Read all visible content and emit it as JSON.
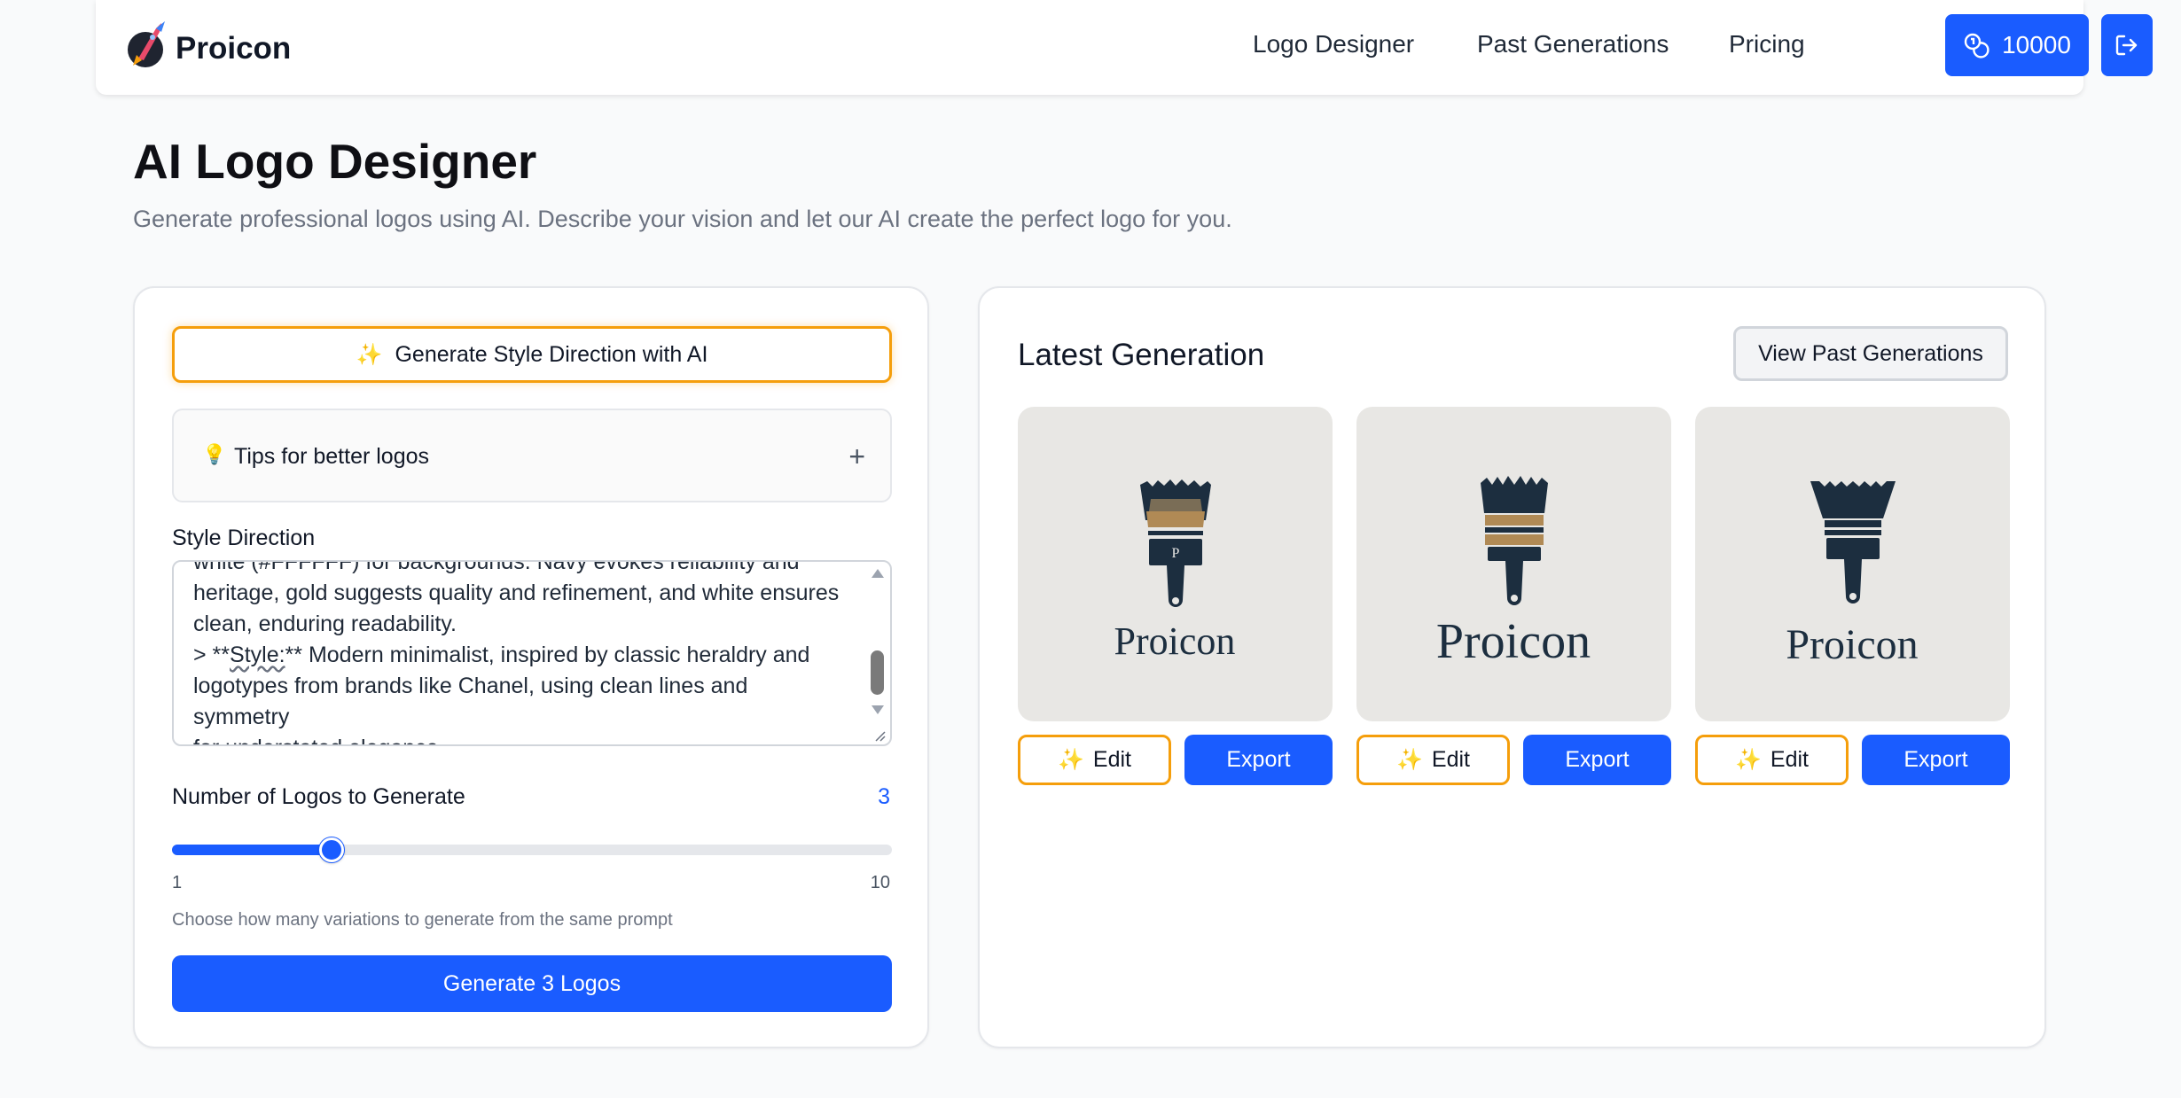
{
  "nav": {
    "brand": "Proicon",
    "links": [
      "Logo Designer",
      "Past Generations",
      "Pricing"
    ],
    "credits": "10000",
    "icons": {
      "credits": "coins-icon",
      "logout": "logout-icon",
      "brand": "rocket-logo-icon"
    }
  },
  "header": {
    "title": "AI Logo Designer",
    "subtitle": "Generate professional logos using AI. Describe your vision and let our AI create the perfect logo for you."
  },
  "form": {
    "ai_button": "Generate Style Direction with AI",
    "tips_label": "Tips for better logos",
    "tips_toggle": "+",
    "style_label": "Style Direction",
    "style_text_1": "white (#FFFFFF) for backgrounds. Navy evokes reliability and\nheritage, gold suggests quality and refinement, and white ensures\nclean, enduring readability.\n> **",
    "style_text_2": "Style:",
    "style_text_3": "** Modern minimalist, inspired by classic heraldry and\nlogotypes from brands like Chanel, using clean lines and symmetry\nfor understated elegance.",
    "count_label": "Number of Logos to Generate",
    "count_value": "3",
    "slider_min": "1",
    "slider_max": "10",
    "slider": {
      "min": 1,
      "max": 10,
      "value": 3
    },
    "slider_help": "Choose how many variations to generate from the same prompt",
    "generate_button": "Generate 3 Logos"
  },
  "results": {
    "title": "Latest Generation",
    "view_past_button": "View Past Generations",
    "logos": [
      {
        "wordmark": "Proicon",
        "brush_letter": "P",
        "edit": "Edit",
        "export": "Export"
      },
      {
        "wordmark": "Proicon",
        "edit": "Edit",
        "export": "Export"
      },
      {
        "wordmark": "Proicon",
        "edit": "Edit",
        "export": "Export"
      }
    ]
  },
  "colors": {
    "primary": "#1a5cff",
    "accent": "#f59e0b",
    "navy": "#1c2e3f",
    "gold": "#b08a55",
    "tile_bg": "#e8e7e4"
  }
}
